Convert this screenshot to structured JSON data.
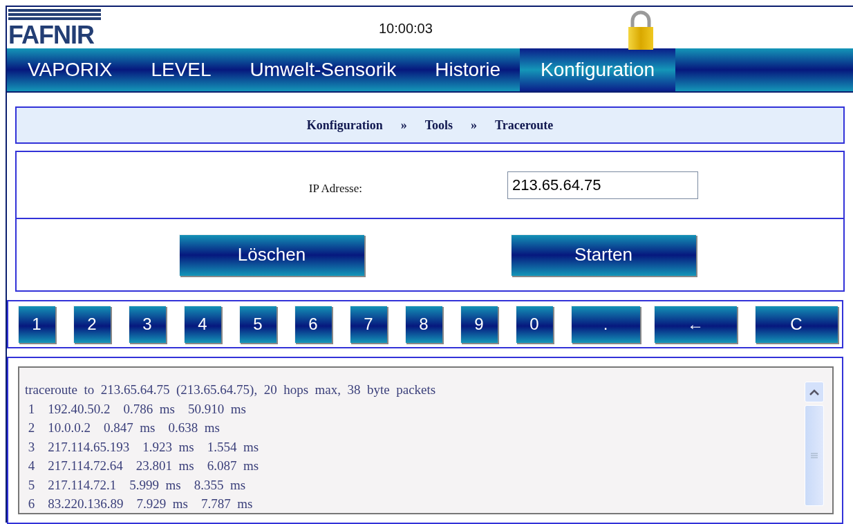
{
  "header": {
    "logo": "FAFNIR",
    "time": "10:00:03"
  },
  "tabs": [
    {
      "label": "VAPORIX",
      "selected": false
    },
    {
      "label": "LEVEL",
      "selected": false
    },
    {
      "label": "Umwelt-Sensorik",
      "selected": false
    },
    {
      "label": "Historie",
      "selected": false
    },
    {
      "label": "Konfiguration",
      "selected": true
    }
  ],
  "breadcrumb": [
    {
      "label": "Konfiguration",
      "separator": "»"
    },
    {
      "label": "Tools",
      "separator": "»"
    },
    {
      "label": "Traceroute"
    }
  ],
  "ip_field": {
    "label": "IP Adresse:",
    "value": "213.65.64.75"
  },
  "actions": [
    "Löschen",
    "Starten"
  ],
  "keypad": [
    {
      "label": "1",
      "kind": "digit"
    },
    {
      "label": "2",
      "kind": "digit"
    },
    {
      "label": "3",
      "kind": "digit"
    },
    {
      "label": "4",
      "kind": "digit"
    },
    {
      "label": "5",
      "kind": "digit"
    },
    {
      "label": "6",
      "kind": "digit"
    },
    {
      "label": "7",
      "kind": "digit"
    },
    {
      "label": "8",
      "kind": "digit"
    },
    {
      "label": "9",
      "kind": "digit"
    },
    {
      "label": "0",
      "kind": "digit"
    },
    {
      "label": ".",
      "kind": "wide"
    },
    {
      "label": "←",
      "kind": "wider"
    },
    {
      "label": "C",
      "kind": "wider"
    }
  ],
  "output": {
    "lines": [
      "traceroute  to  213.65.64.75  (213.65.64.75),  20  hops  max,  38  byte  packets",
      " 1    192.40.50.2    0.786  ms    50.910  ms",
      " 2    10.0.0.2    0.847  ms    0.638  ms",
      " 3    217.114.65.193    1.923  ms    1.554  ms",
      " 4    217.114.72.64    23.801  ms    6.087  ms",
      " 5    217.114.72.1    5.999  ms    8.355  ms",
      " 6    83.220.136.89    7.929  ms    7.787  ms"
    ]
  }
}
